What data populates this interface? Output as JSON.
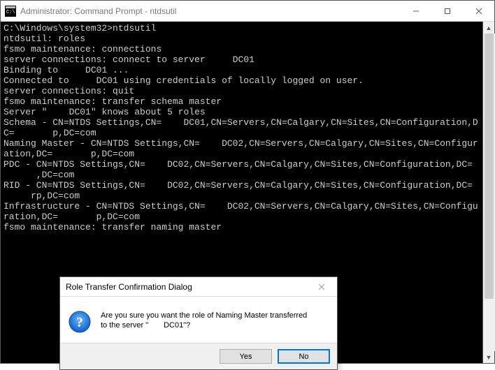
{
  "window": {
    "title": "Administrator: Command Prompt - ntdsutil"
  },
  "terminal": {
    "prompt_path": "C:\\Windows\\system32>",
    "cmd_launch": "ntdsutil",
    "line_roles_prompt": "ntdsutil: ",
    "line_roles_cmd": "roles",
    "line_fsmo_conn_prompt": "fsmo maintenance: ",
    "line_fsmo_conn_cmd": "connections",
    "line_conn_to_prompt": "server connections: ",
    "line_conn_to_cmd_prefix": "connect to server ",
    "line_conn_to_cmd_suffix": "DC01",
    "line_binding_prefix": "Binding to ",
    "line_binding_suffix": "DC01 ...",
    "line_connected_prefix": "Connected to ",
    "line_connected_mid": "DC01 using credentials of locally logged on user.",
    "line_conn_quit_prompt": "server connections: ",
    "line_conn_quit_cmd": "quit",
    "line_fsmo_xfer_prompt": "fsmo maintenance: ",
    "line_fsmo_xfer_cmd": "transfer schema master",
    "line_server_knows_prefix": "Server \"",
    "line_server_knows_mid": "DC01\" knows about 5 roles",
    "line_schema_prefix": "Schema - CN=NTDS Settings,CN=",
    "line_schema_mid": "DC01,CN=Servers,CN=Calgary,CN=Sites,CN=Configuration,DC=",
    "line_schema_suffix": "p,DC=com",
    "line_naming_prefix": "Naming Master - CN=NTDS Settings,CN=",
    "line_naming_mid": "DC02,CN=Servers,CN=Calgary,CN=Sites,CN=Configuration,DC=",
    "line_naming_suffix": "p,DC=com",
    "line_pdc_prefix": "PDC - CN=NTDS Settings,CN=",
    "line_pdc_mid": "DC02,CN=Servers,CN=Calgary,CN=Sites,CN=Configuration,DC=",
    "line_pdc_suffix": ",DC=com",
    "line_rid_prefix": "RID - CN=NTDS Settings,CN=",
    "line_rid_mid": "DC02,CN=Servers,CN=Calgary,CN=Sites,CN=Configuration,DC=",
    "line_rid_suffix": "rp,DC=com",
    "line_infra_prefix": "Infrastructure - CN=NTDS Settings,CN=",
    "line_infra_mid": "DC02,CN=Servers,CN=Calgary,CN=Sites,CN=Configuration,DC=",
    "line_infra_suffix": "p,DC=com",
    "line_fsmo_naming_prompt": "fsmo maintenance: ",
    "line_fsmo_naming_cmd": "transfer naming master"
  },
  "dialog": {
    "title": "Role Transfer Confirmation Dialog",
    "message_line1": "Are you sure you want the role of Naming Master transferred",
    "message_line2_prefix": "to the server \"",
    "message_line2_suffix": "DC01\"?",
    "yes_label": "Yes",
    "no_label": "No"
  }
}
